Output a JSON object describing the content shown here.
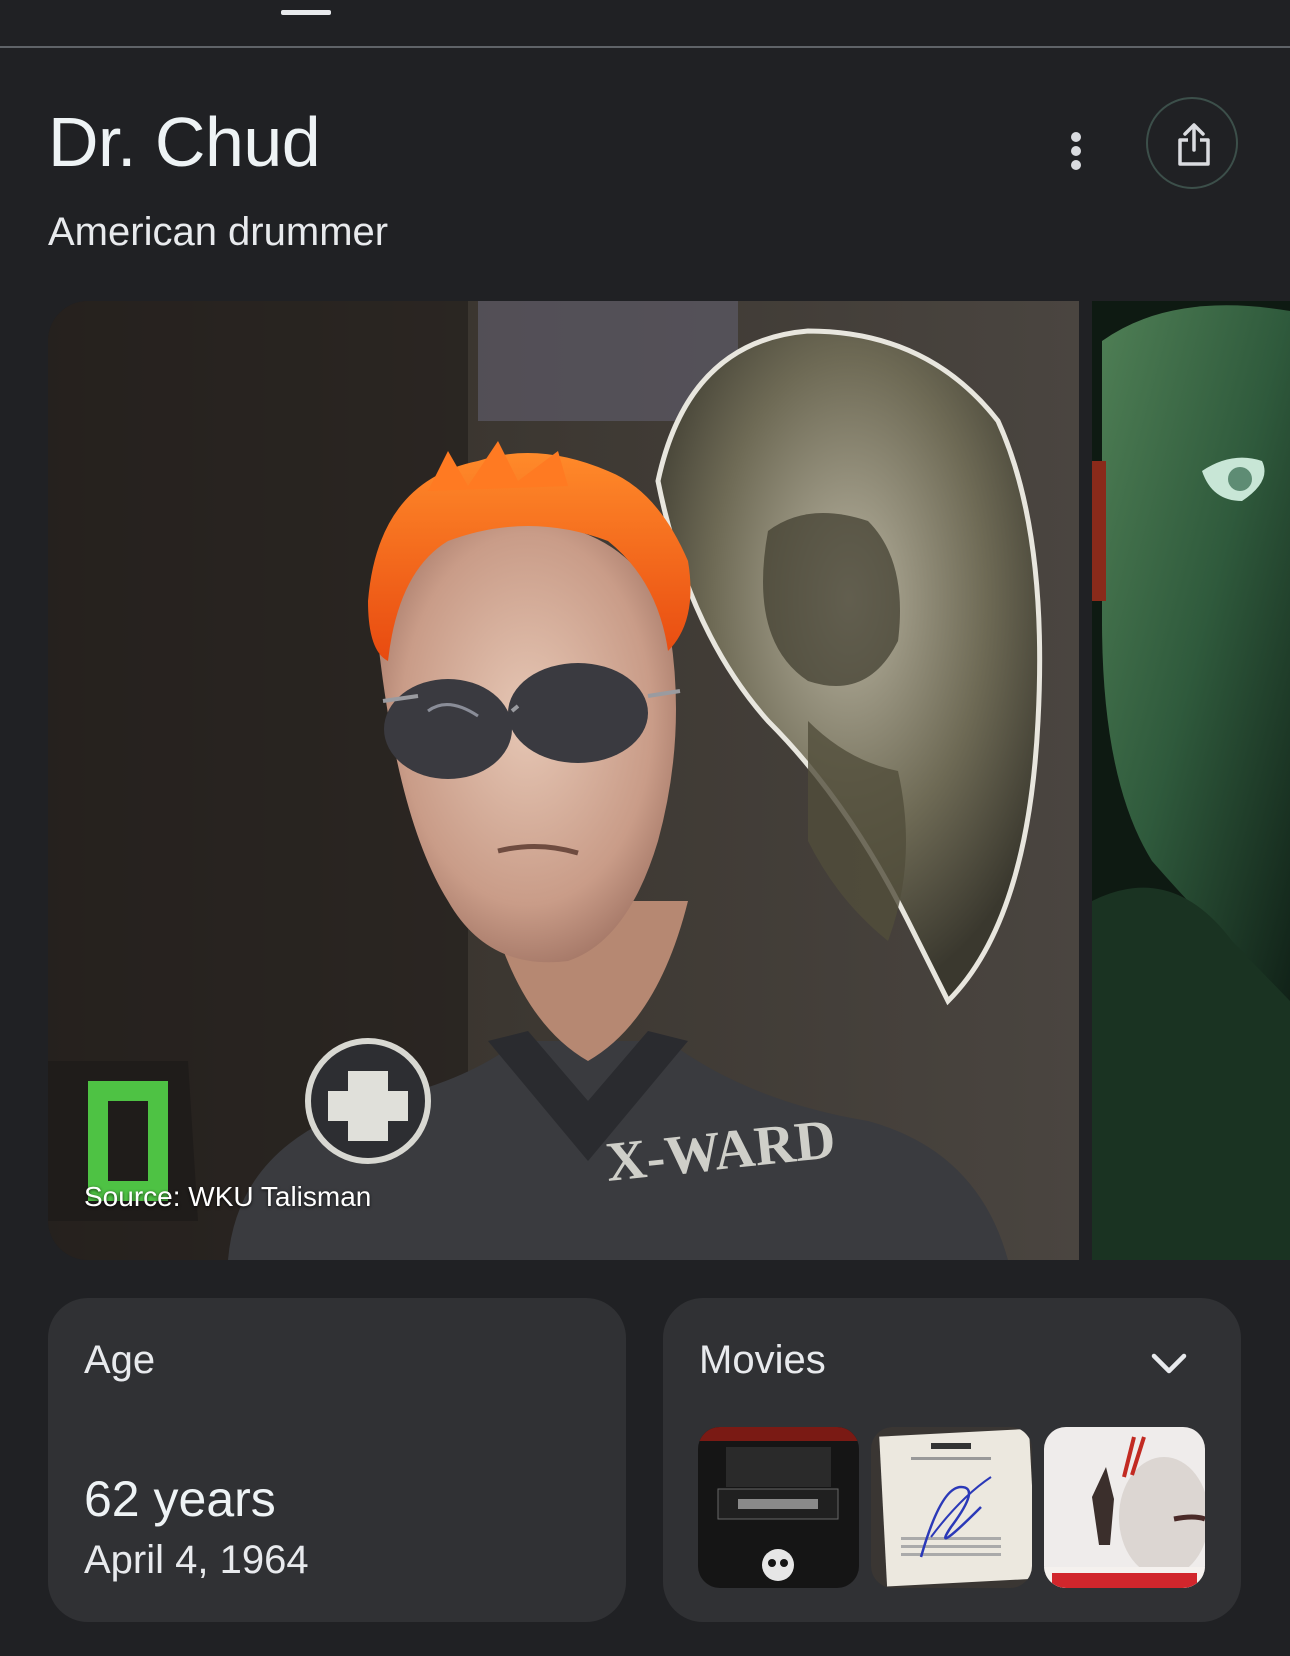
{
  "header": {
    "title": "Dr. Chud",
    "subtitle": "American drummer",
    "more_icon": "more-vertical-icon",
    "share_icon": "share-icon"
  },
  "images": {
    "source_label": "Source: WKU Talisman"
  },
  "age_card": {
    "label": "Age",
    "value": "62 years",
    "date": "April 4, 1964"
  },
  "movies_card": {
    "label": "Movies",
    "expand_icon": "chevron-down-icon",
    "thumbnails": [
      "movie-poster-1",
      "movie-poster-2",
      "movie-poster-3"
    ]
  },
  "colors": {
    "background": "#202124",
    "card": "#303134",
    "text": "#e8eaed",
    "hair_accent": "#ff5a14"
  }
}
